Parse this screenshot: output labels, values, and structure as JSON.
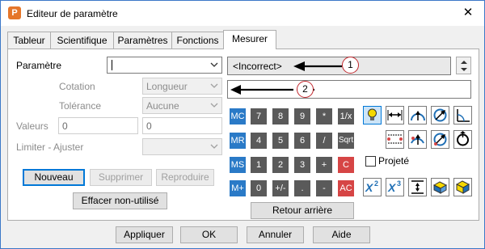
{
  "window": {
    "title": "Editeur de paramètre",
    "app_icon": "P",
    "close_glyph": "✕"
  },
  "tabs": [
    {
      "label": "Tableur"
    },
    {
      "label": "Scientifique"
    },
    {
      "label": "Paramètres"
    },
    {
      "label": "Fonctions"
    },
    {
      "label": "Mesurer"
    }
  ],
  "form": {
    "parametre_label": "Paramètre",
    "parametre_value": "",
    "cotation_label": "Cotation",
    "cotation_value": "Longueur",
    "tolerance_label": "Tolérance",
    "tolerance_value": "Aucune",
    "valeurs_label": "Valeurs",
    "valeurs_min": "0",
    "valeurs_max": "0",
    "limiter_label": "Limiter - Ajuster",
    "limiter_value": ""
  },
  "buttons": {
    "nouveau": "Nouveau",
    "supprimer": "Supprimer",
    "reproduire": "Reproduire",
    "effacer": "Effacer non-utilisé",
    "retour": "Retour arrière",
    "appliquer": "Appliquer",
    "ok": "OK",
    "annuler": "Annuler",
    "aide": "Aide"
  },
  "display": {
    "line1": "<Incorrect>",
    "line2": "",
    "callout1": "1",
    "callout2": "2"
  },
  "keypad": {
    "rows": [
      [
        "MC",
        "7",
        "8",
        "9",
        "*",
        "1/x"
      ],
      [
        "MR",
        "4",
        "5",
        "6",
        "/",
        "Sqrt"
      ],
      [
        "MS",
        "1",
        "2",
        "3",
        "+",
        "C"
      ],
      [
        "M+",
        "0",
        "+/-",
        ".",
        "-",
        "AC"
      ]
    ]
  },
  "projete_label": "Projeté",
  "icons": {
    "row1": [
      "light-bulb-icon",
      "horizontal-distance-icon",
      "arc-radius-icon",
      "diameter-icon",
      "angle-icon"
    ],
    "row2": [
      "dotted-distance-icon",
      "point-normal-icon",
      "point-distance-icon",
      "circle-rotate-icon"
    ],
    "row3": [
      "area-icon",
      "volume-icon",
      "thickness-icon",
      "surface-box-icon",
      "solid-box-icon"
    ]
  },
  "colors": {
    "accent": "#0078d7",
    "keypad_blue": "#2a7ac7",
    "keypad_dark": "#5a5a5a",
    "keypad_red": "#d64545",
    "app_icon": "#e5762a"
  }
}
